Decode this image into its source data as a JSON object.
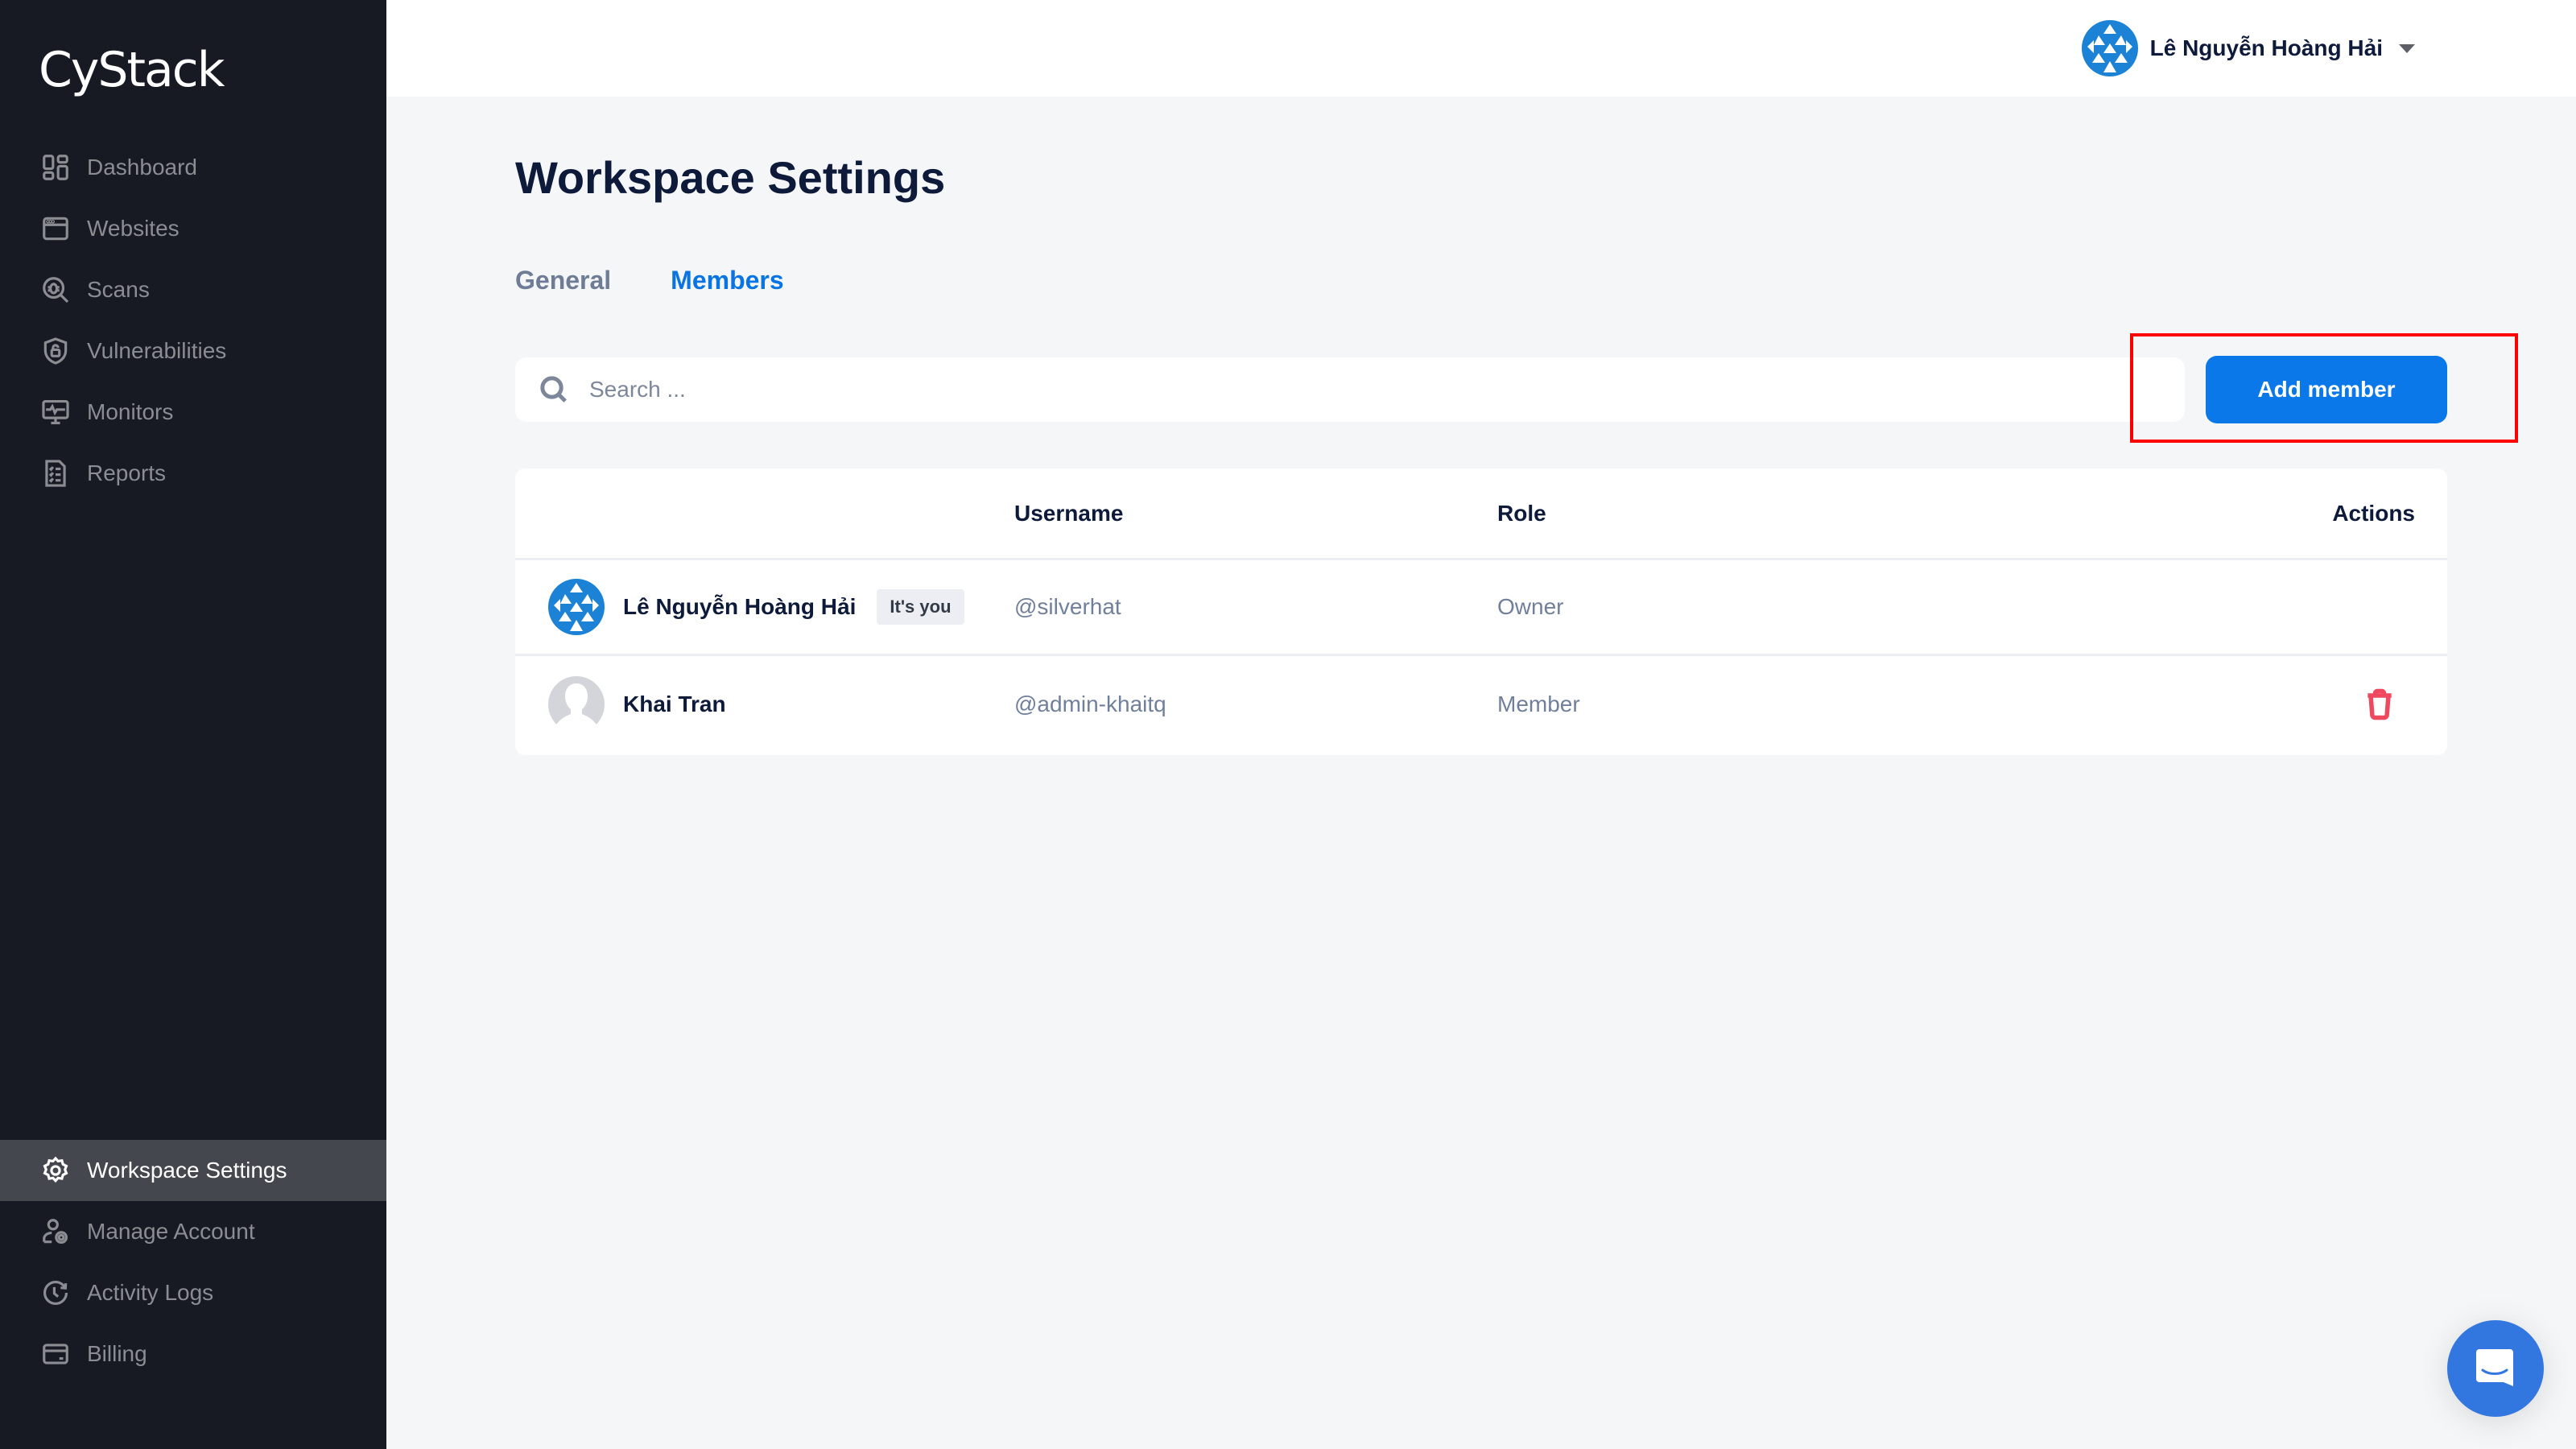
{
  "brand": {
    "logo_text": "CyStack"
  },
  "sidebar": {
    "top_items": [
      {
        "label": "Dashboard",
        "icon": "dashboard-icon"
      },
      {
        "label": "Websites",
        "icon": "browser-window-icon"
      },
      {
        "label": "Scans",
        "icon": "bug-search-icon"
      },
      {
        "label": "Vulnerabilities",
        "icon": "shield-lock-icon"
      },
      {
        "label": "Monitors",
        "icon": "monitor-pulse-icon"
      },
      {
        "label": "Reports",
        "icon": "checklist-report-icon"
      }
    ],
    "bottom_items": [
      {
        "label": "Workspace Settings",
        "icon": "gear-icon",
        "active": true
      },
      {
        "label": "Manage Account",
        "icon": "user-gear-icon"
      },
      {
        "label": "Activity Logs",
        "icon": "clock-history-icon"
      },
      {
        "label": "Billing",
        "icon": "credit-card-icon"
      }
    ]
  },
  "header": {
    "user_name": "Lê Nguyễn Hoàng Hải"
  },
  "main": {
    "title": "Workspace Settings",
    "tabs": [
      {
        "label": "General",
        "active": false
      },
      {
        "label": "Members",
        "active": true
      }
    ],
    "search": {
      "placeholder": "Search ...",
      "value": ""
    },
    "add_member_label": "Add member",
    "table": {
      "columns": [
        "",
        "Username",
        "Role",
        "Actions"
      ],
      "rows": [
        {
          "name": "Lê Nguyễn Hoàng Hải",
          "badge": "It's you",
          "username": "@silverhat",
          "role": "Owner",
          "can_delete": false
        },
        {
          "name": "Khai Tran",
          "badge": "",
          "username": "@admin-khaitq",
          "role": "Member",
          "can_delete": true
        }
      ]
    }
  },
  "colors": {
    "accent": "#0a78e8",
    "sidebar_bg": "#171a23",
    "sidebar_active": "#45474f",
    "danger": "#f0485e",
    "highlight": "#ff0000"
  }
}
